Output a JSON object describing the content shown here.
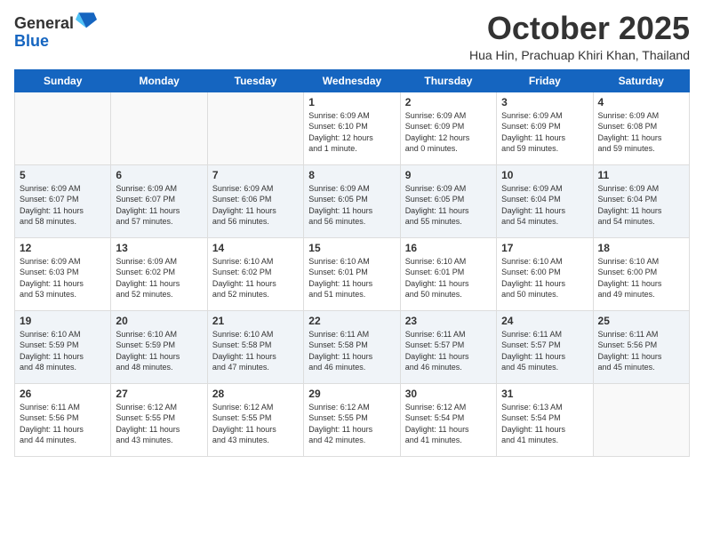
{
  "header": {
    "logo_general": "General",
    "logo_blue": "Blue",
    "month": "October 2025",
    "location": "Hua Hin, Prachuap Khiri Khan, Thailand"
  },
  "weekdays": [
    "Sunday",
    "Monday",
    "Tuesday",
    "Wednesday",
    "Thursday",
    "Friday",
    "Saturday"
  ],
  "weeks": [
    [
      {
        "num": "",
        "info": ""
      },
      {
        "num": "",
        "info": ""
      },
      {
        "num": "",
        "info": ""
      },
      {
        "num": "1",
        "info": "Sunrise: 6:09 AM\nSunset: 6:10 PM\nDaylight: 12 hours\nand 1 minute."
      },
      {
        "num": "2",
        "info": "Sunrise: 6:09 AM\nSunset: 6:09 PM\nDaylight: 12 hours\nand 0 minutes."
      },
      {
        "num": "3",
        "info": "Sunrise: 6:09 AM\nSunset: 6:09 PM\nDaylight: 11 hours\nand 59 minutes."
      },
      {
        "num": "4",
        "info": "Sunrise: 6:09 AM\nSunset: 6:08 PM\nDaylight: 11 hours\nand 59 minutes."
      }
    ],
    [
      {
        "num": "5",
        "info": "Sunrise: 6:09 AM\nSunset: 6:07 PM\nDaylight: 11 hours\nand 58 minutes."
      },
      {
        "num": "6",
        "info": "Sunrise: 6:09 AM\nSunset: 6:07 PM\nDaylight: 11 hours\nand 57 minutes."
      },
      {
        "num": "7",
        "info": "Sunrise: 6:09 AM\nSunset: 6:06 PM\nDaylight: 11 hours\nand 56 minutes."
      },
      {
        "num": "8",
        "info": "Sunrise: 6:09 AM\nSunset: 6:05 PM\nDaylight: 11 hours\nand 56 minutes."
      },
      {
        "num": "9",
        "info": "Sunrise: 6:09 AM\nSunset: 6:05 PM\nDaylight: 11 hours\nand 55 minutes."
      },
      {
        "num": "10",
        "info": "Sunrise: 6:09 AM\nSunset: 6:04 PM\nDaylight: 11 hours\nand 54 minutes."
      },
      {
        "num": "11",
        "info": "Sunrise: 6:09 AM\nSunset: 6:04 PM\nDaylight: 11 hours\nand 54 minutes."
      }
    ],
    [
      {
        "num": "12",
        "info": "Sunrise: 6:09 AM\nSunset: 6:03 PM\nDaylight: 11 hours\nand 53 minutes."
      },
      {
        "num": "13",
        "info": "Sunrise: 6:09 AM\nSunset: 6:02 PM\nDaylight: 11 hours\nand 52 minutes."
      },
      {
        "num": "14",
        "info": "Sunrise: 6:10 AM\nSunset: 6:02 PM\nDaylight: 11 hours\nand 52 minutes."
      },
      {
        "num": "15",
        "info": "Sunrise: 6:10 AM\nSunset: 6:01 PM\nDaylight: 11 hours\nand 51 minutes."
      },
      {
        "num": "16",
        "info": "Sunrise: 6:10 AM\nSunset: 6:01 PM\nDaylight: 11 hours\nand 50 minutes."
      },
      {
        "num": "17",
        "info": "Sunrise: 6:10 AM\nSunset: 6:00 PM\nDaylight: 11 hours\nand 50 minutes."
      },
      {
        "num": "18",
        "info": "Sunrise: 6:10 AM\nSunset: 6:00 PM\nDaylight: 11 hours\nand 49 minutes."
      }
    ],
    [
      {
        "num": "19",
        "info": "Sunrise: 6:10 AM\nSunset: 5:59 PM\nDaylight: 11 hours\nand 48 minutes."
      },
      {
        "num": "20",
        "info": "Sunrise: 6:10 AM\nSunset: 5:59 PM\nDaylight: 11 hours\nand 48 minutes."
      },
      {
        "num": "21",
        "info": "Sunrise: 6:10 AM\nSunset: 5:58 PM\nDaylight: 11 hours\nand 47 minutes."
      },
      {
        "num": "22",
        "info": "Sunrise: 6:11 AM\nSunset: 5:58 PM\nDaylight: 11 hours\nand 46 minutes."
      },
      {
        "num": "23",
        "info": "Sunrise: 6:11 AM\nSunset: 5:57 PM\nDaylight: 11 hours\nand 46 minutes."
      },
      {
        "num": "24",
        "info": "Sunrise: 6:11 AM\nSunset: 5:57 PM\nDaylight: 11 hours\nand 45 minutes."
      },
      {
        "num": "25",
        "info": "Sunrise: 6:11 AM\nSunset: 5:56 PM\nDaylight: 11 hours\nand 45 minutes."
      }
    ],
    [
      {
        "num": "26",
        "info": "Sunrise: 6:11 AM\nSunset: 5:56 PM\nDaylight: 11 hours\nand 44 minutes."
      },
      {
        "num": "27",
        "info": "Sunrise: 6:12 AM\nSunset: 5:55 PM\nDaylight: 11 hours\nand 43 minutes."
      },
      {
        "num": "28",
        "info": "Sunrise: 6:12 AM\nSunset: 5:55 PM\nDaylight: 11 hours\nand 43 minutes."
      },
      {
        "num": "29",
        "info": "Sunrise: 6:12 AM\nSunset: 5:55 PM\nDaylight: 11 hours\nand 42 minutes."
      },
      {
        "num": "30",
        "info": "Sunrise: 6:12 AM\nSunset: 5:54 PM\nDaylight: 11 hours\nand 41 minutes."
      },
      {
        "num": "31",
        "info": "Sunrise: 6:13 AM\nSunset: 5:54 PM\nDaylight: 11 hours\nand 41 minutes."
      },
      {
        "num": "",
        "info": ""
      }
    ]
  ]
}
